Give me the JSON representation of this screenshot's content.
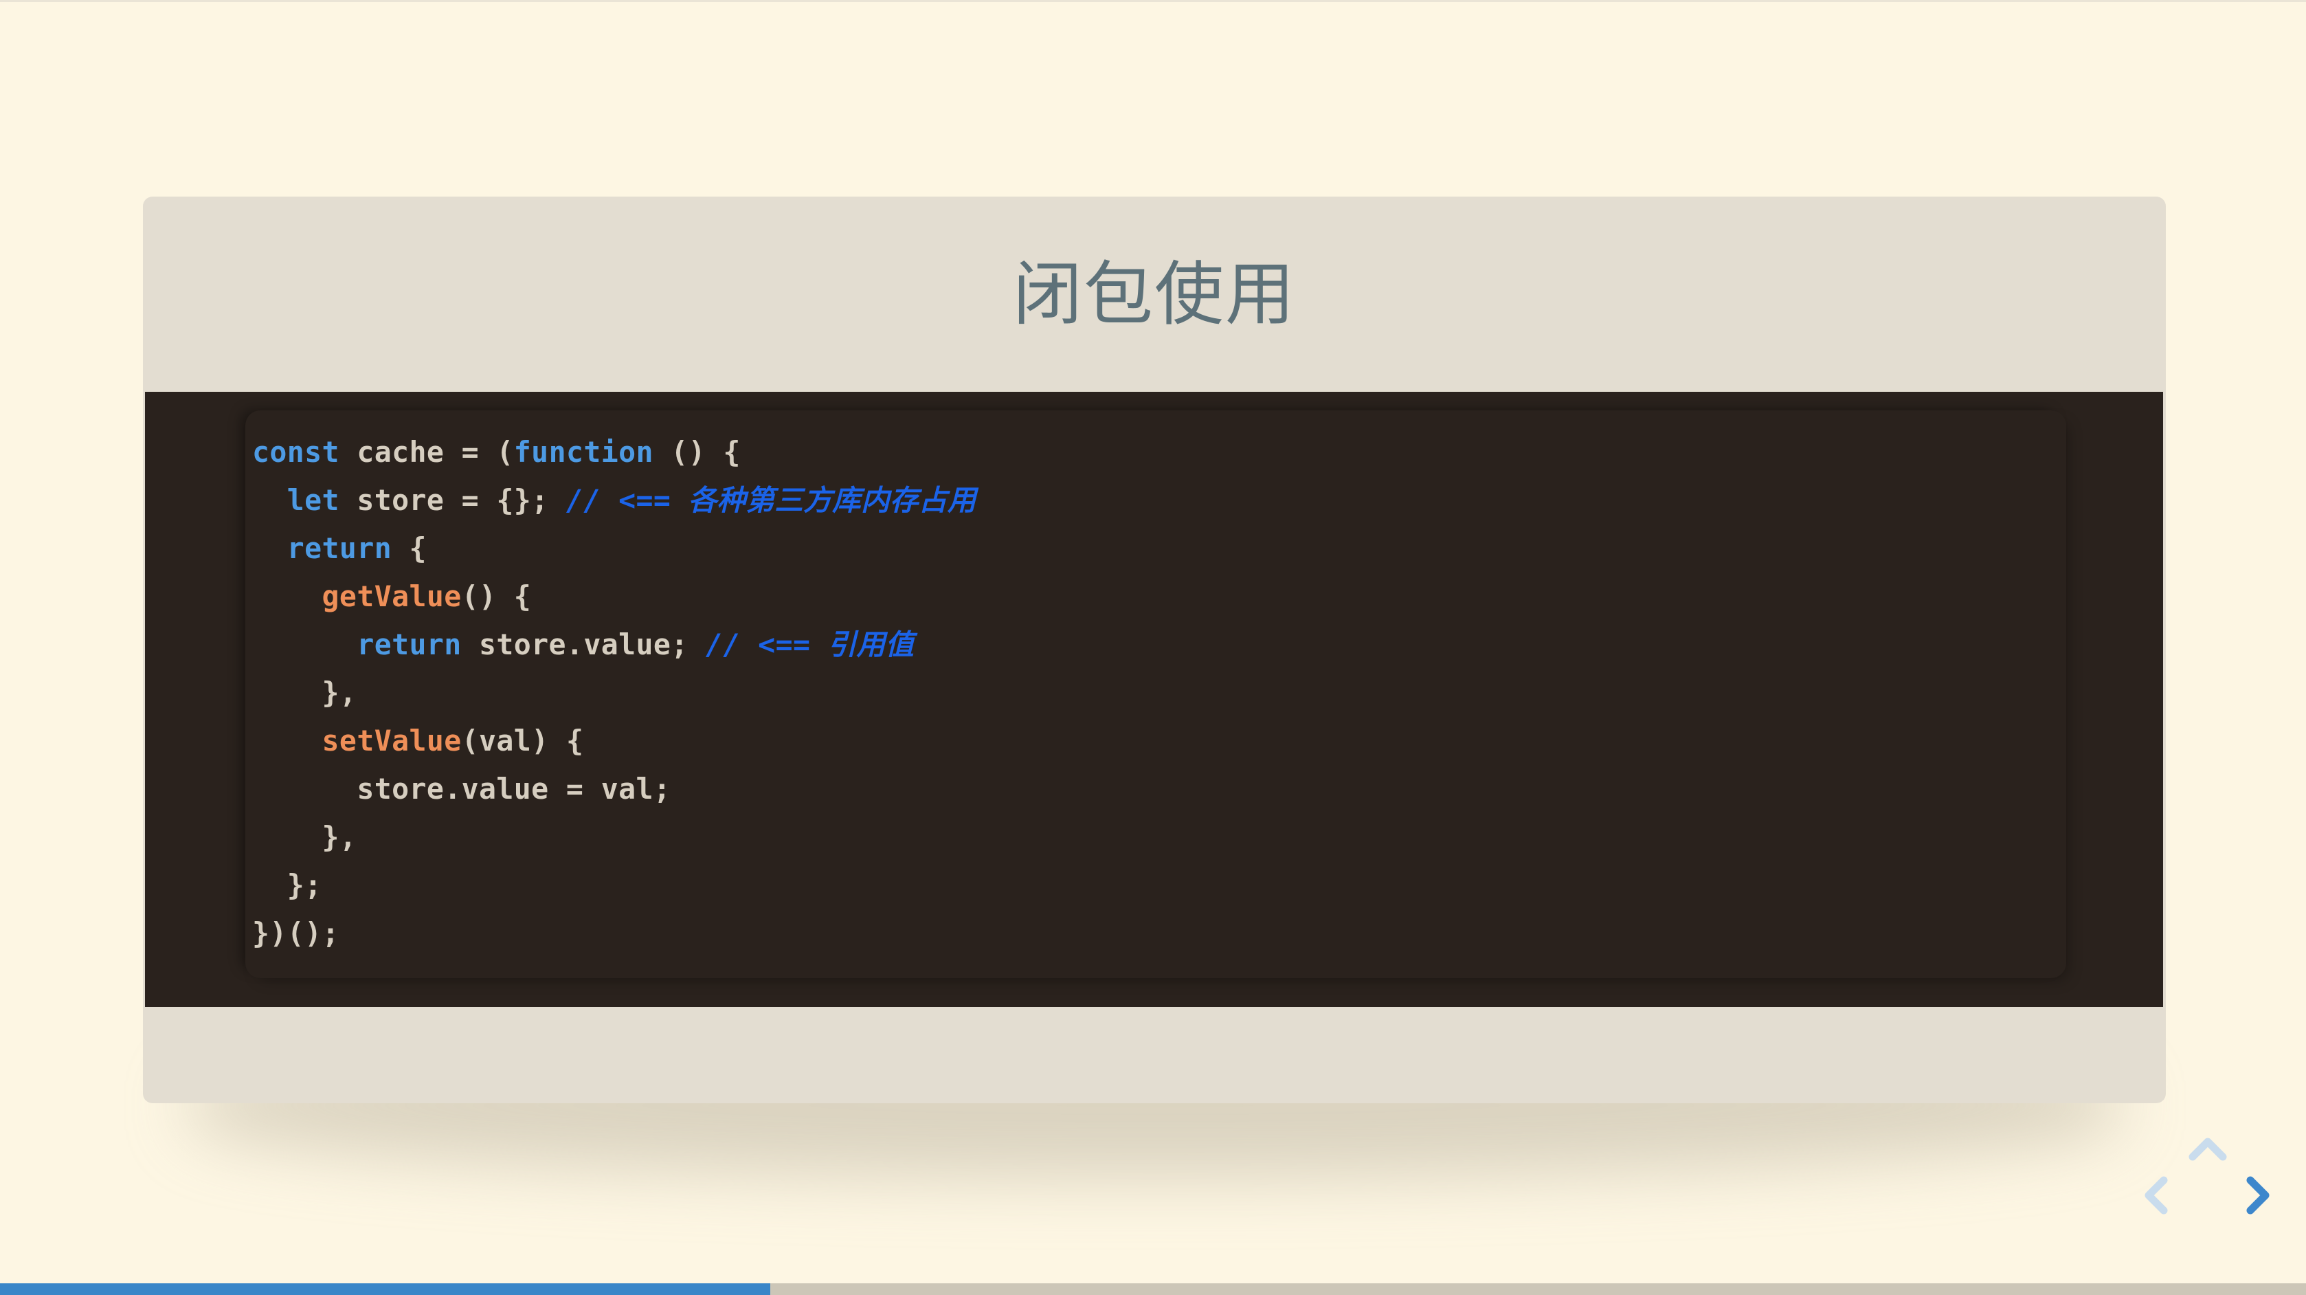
{
  "presentation": {
    "background_color": "#fdf6e3",
    "slide_card_color": "#e3ddd1"
  },
  "slide": {
    "title": "闭包使用",
    "title_color": "#5d7179"
  },
  "code_block": {
    "language": "javascript",
    "background_color": "#2a221d",
    "lines": [
      {
        "indent": 0,
        "tokens": [
          {
            "t": "const",
            "c": "kw"
          },
          {
            "t": " cache = (",
            "c": "pl"
          },
          {
            "t": "function",
            "c": "kw"
          },
          {
            "t": " () {",
            "c": "pl"
          }
        ]
      },
      {
        "indent": 1,
        "tokens": [
          {
            "t": "let",
            "c": "kw"
          },
          {
            "t": " store = {}; ",
            "c": "pl"
          },
          {
            "t": "// <== ",
            "c": "cm"
          },
          {
            "t": "各种第三方库内存占用",
            "c": "cm-cjk"
          }
        ]
      },
      {
        "indent": 1,
        "tokens": [
          {
            "t": "return",
            "c": "kw"
          },
          {
            "t": " {",
            "c": "pl"
          }
        ]
      },
      {
        "indent": 2,
        "tokens": [
          {
            "t": "getValue",
            "c": "fn"
          },
          {
            "t": "() {",
            "c": "pl"
          }
        ]
      },
      {
        "indent": 3,
        "tokens": [
          {
            "t": "return",
            "c": "kw"
          },
          {
            "t": " store.value; ",
            "c": "pl"
          },
          {
            "t": "// <== ",
            "c": "cm"
          },
          {
            "t": "引用值",
            "c": "cm-cjk"
          }
        ]
      },
      {
        "indent": 2,
        "tokens": [
          {
            "t": "},",
            "c": "pl"
          }
        ]
      },
      {
        "indent": 2,
        "tokens": [
          {
            "t": "setValue",
            "c": "fn"
          },
          {
            "t": "(val) {",
            "c": "pl"
          }
        ]
      },
      {
        "indent": 3,
        "tokens": [
          {
            "t": "store.value = val;",
            "c": "pl"
          }
        ]
      },
      {
        "indent": 2,
        "tokens": [
          {
            "t": "},",
            "c": "pl"
          }
        ]
      },
      {
        "indent": 1,
        "tokens": [
          {
            "t": "};",
            "c": "pl"
          }
        ]
      },
      {
        "indent": 0,
        "tokens": [
          {
            "t": "})();",
            "c": "pl"
          }
        ]
      }
    ],
    "colors": {
      "keyword": "#4d9ae3",
      "function": "#ef8f58",
      "plain": "#d6cec0",
      "comment": "#1b63e8"
    }
  },
  "navigation": {
    "up": {
      "label": "上一节",
      "state": "disabled",
      "color": "#c9dced"
    },
    "left": {
      "label": "上一页",
      "state": "disabled",
      "color": "#c9dced"
    },
    "right": {
      "label": "下一页",
      "state": "enabled",
      "color": "#3d87cc"
    }
  },
  "progress": {
    "percent": 33.4,
    "fill_color": "#3a86c8",
    "track_color": "#ccc6b7"
  }
}
